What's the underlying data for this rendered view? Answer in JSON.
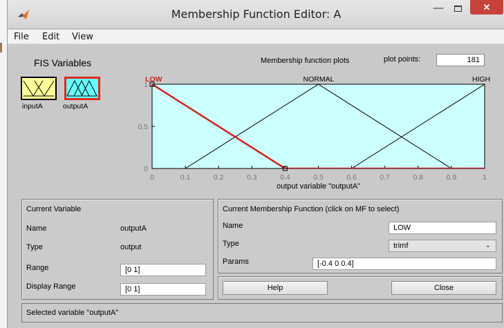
{
  "window": {
    "title": "Membership Function Editor: A",
    "close_label": "✕",
    "min_label": "—"
  },
  "menu": [
    "File",
    "Edit",
    "View"
  ],
  "fis": {
    "title": "FIS Variables",
    "variables": [
      {
        "name": "inputA",
        "color": "#ffff99",
        "selected": false
      },
      {
        "name": "outputA",
        "color": "#66ffff",
        "selected": true
      }
    ]
  },
  "plot": {
    "header_label": "Membership function plots",
    "points_label": "plot points:",
    "points_value": "181"
  },
  "chart_data": {
    "type": "line",
    "xlabel": "output variable \"outputA\"",
    "xlim": [
      0,
      1
    ],
    "ylim": [
      0,
      1
    ],
    "xticks": [
      "0",
      "0.1",
      "0.2",
      "0.3",
      "0.4",
      "0.5",
      "0.6",
      "0.7",
      "0.8",
      "0.9",
      "1"
    ],
    "yticks": [
      "0",
      "0.5",
      "1"
    ],
    "background": "#ccffff",
    "selected_color": "#d42018",
    "series": [
      {
        "name": "LOW",
        "x": [
          -0.4,
          0,
          0.4,
          1
        ],
        "y": [
          0,
          1,
          0,
          0
        ],
        "selected": true
      },
      {
        "name": "NORMAL",
        "x": [
          0,
          0.1,
          0.5,
          0.9,
          1
        ],
        "y": [
          0,
          0,
          1,
          0,
          0
        ],
        "selected": false
      },
      {
        "name": "HIGH",
        "x": [
          0,
          0.6,
          1
        ],
        "y": [
          0,
          0,
          1
        ],
        "selected": false
      }
    ]
  },
  "current_variable": {
    "title": "Current Variable",
    "name_label": "Name",
    "name_value": "outputA",
    "type_label": "Type",
    "type_value": "output",
    "range_label": "Range",
    "range_value": "[0 1]",
    "display_range_label": "Display Range",
    "display_range_value": "[0 1]"
  },
  "current_mf": {
    "title": "Current Membership Function (click on MF to select)",
    "name_label": "Name",
    "name_value": "LOW",
    "type_label": "Type",
    "type_value": "trimf",
    "params_label": "Params",
    "params_value": "[-0.4 0 0.4]"
  },
  "buttons": {
    "help": "Help",
    "close": "Close"
  },
  "status": "Selected variable \"outputA\""
}
